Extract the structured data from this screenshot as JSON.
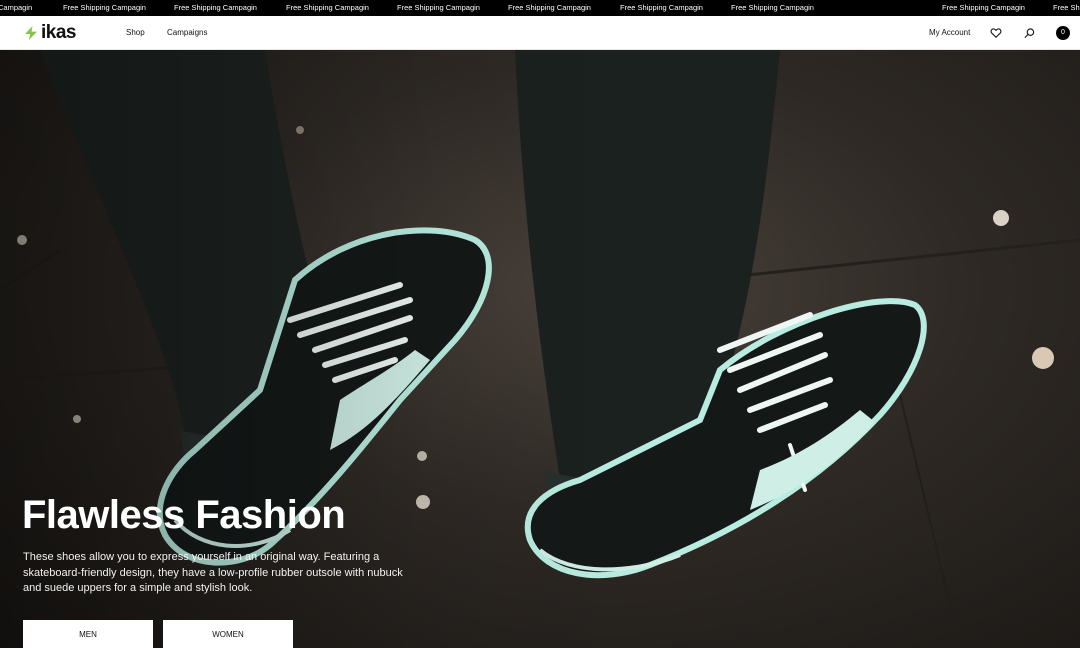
{
  "announcement": {
    "items": [
      "Campagin",
      "Free Shipping Campagin",
      "Free Shipping Campagin",
      "Free Shipping Campagin",
      "Free Shipping Campagin",
      "Free Shipping Campagin",
      "Free Shipping Campagin",
      "Free Shipping Campagin",
      "Free Shipping Campagin",
      "Free Shi"
    ]
  },
  "header": {
    "logo_text": "ikas",
    "brand_color": "#8bc34a",
    "nav": [
      {
        "label": "Shop"
      },
      {
        "label": "Campaigns"
      }
    ],
    "account_label": "My Account",
    "icons": [
      "heart-icon",
      "search-icon"
    ],
    "cart_count": "0"
  },
  "hero": {
    "title": "Flawless Fashion",
    "description": "These shoes allow you to express yourself in an original way. Featuring a skateboard-friendly design, they have a low-profile rubber outsole with nubuck and suede uppers for a simple and stylish look.",
    "buttons": [
      {
        "label": "MEN"
      },
      {
        "label": "WOMEN"
      }
    ]
  }
}
